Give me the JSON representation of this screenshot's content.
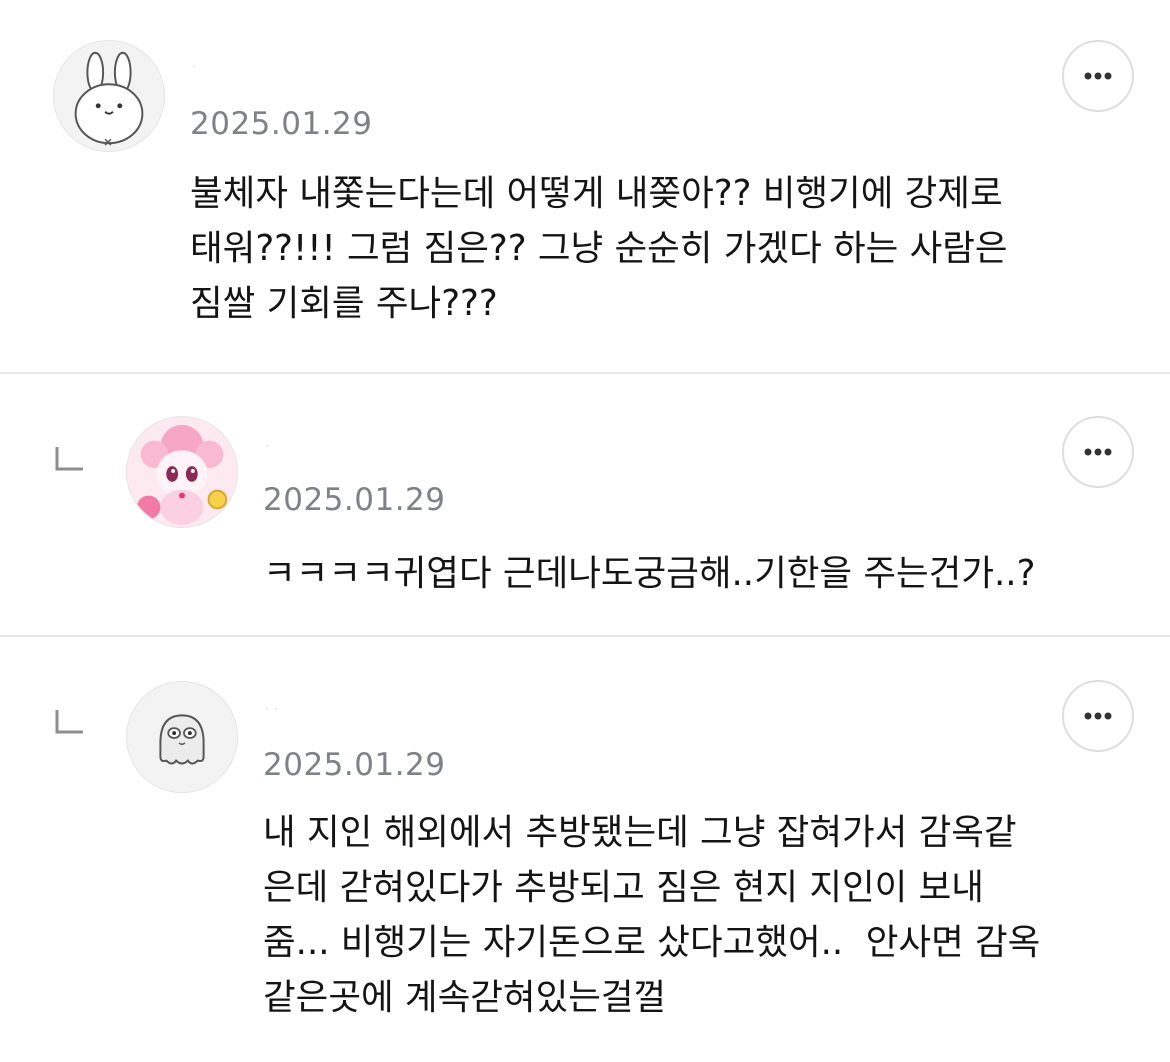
{
  "comments": [
    {
      "username": "·",
      "date": "2025.01.29",
      "avatar_icon": "rabbit-avatar-icon",
      "text": "불체자 내쫓는다는데 어떻게 내쫒아?? 비행기에 강제로\n태워??!!! 그럼 짐은?? 그냥 순순히 가겠다 하는 사람은\n짐쌀 기회를 주나???"
    },
    {
      "username": "·",
      "date": "2025.01.29",
      "avatar_icon": "pink-character-avatar-icon",
      "text": "ㅋㅋㅋㅋ귀엽다 근데나도궁금해..기한을 주는건가..?"
    },
    {
      "username": "· ·",
      "date": "2025.01.29",
      "avatar_icon": "ghost-avatar-icon",
      "text": "내 지인 해외에서 추방됐는데 그냥 잡혀가서 감옥같\n은데 갇혀있다가 추방되고 짐은 현지 지인이 보내\n줌... 비행기는 자기돈으로 샀다고했어..  안사면 감옥\n같은곳에 계속갇혀있는걸껄"
    }
  ],
  "colors": {
    "divider": "#e6e6e6",
    "date": "#7e8185",
    "text": "#141414",
    "pink_avatar": "#f7b3cd"
  }
}
